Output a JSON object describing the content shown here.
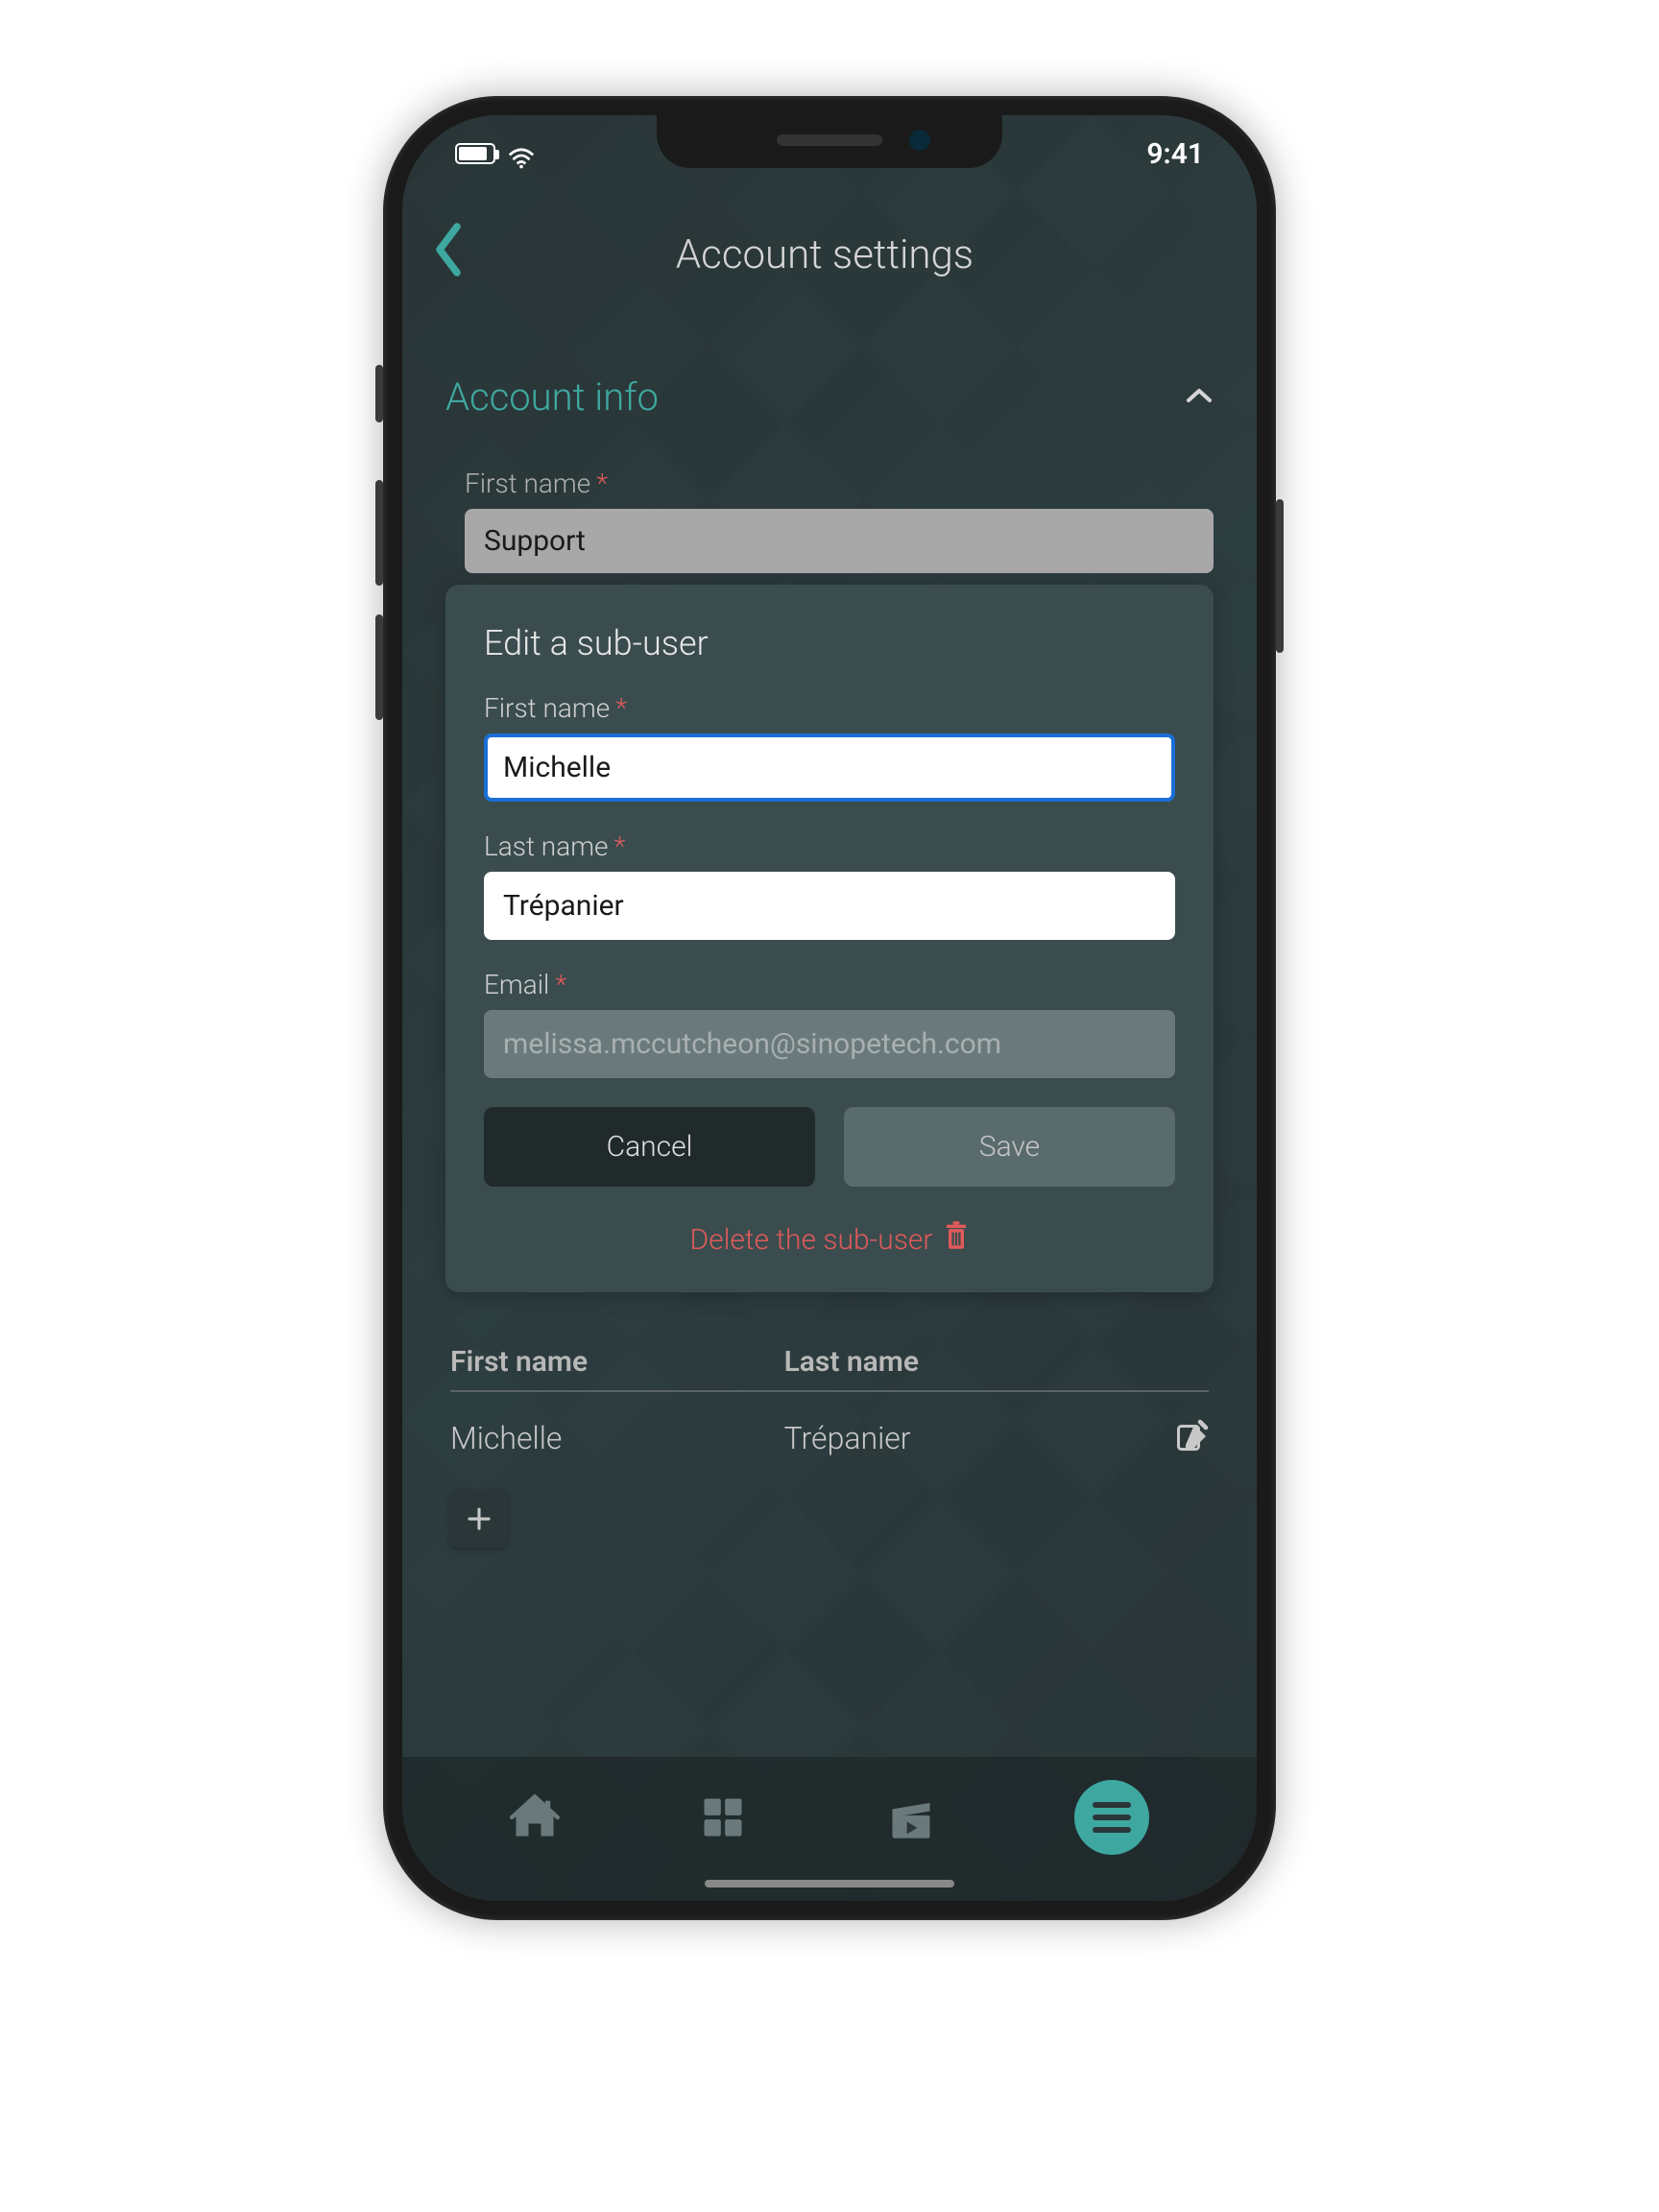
{
  "status_bar": {
    "time": "9:41"
  },
  "header": {
    "title": "Account settings"
  },
  "section": {
    "title": "Account info",
    "first_name_label": "First name",
    "first_name_value": "Support"
  },
  "modal": {
    "title": "Edit a sub-user",
    "first_name_label": "First name",
    "first_name_value": "Michelle",
    "last_name_label": "Last name",
    "last_name_value": "Trépanier",
    "email_label": "Email",
    "email_value": "melissa.mccutcheon@sinopetech.com",
    "cancel_label": "Cancel",
    "save_label": "Save",
    "delete_label": "Delete the sub-user"
  },
  "table": {
    "headers": {
      "first": "First name",
      "last": "Last name"
    },
    "row": {
      "first": "Michelle",
      "last": "Trépanier"
    }
  }
}
